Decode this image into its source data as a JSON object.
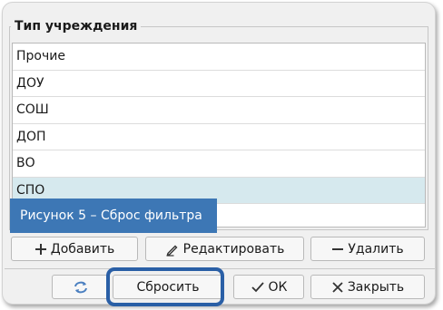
{
  "dialog": {
    "group_title": "Тип учреждения",
    "items": [
      {
        "label": "Прочие"
      },
      {
        "label": "ДОУ"
      },
      {
        "label": "СОШ"
      },
      {
        "label": "ДОП"
      },
      {
        "label": "ВО"
      },
      {
        "label": "СПО"
      }
    ],
    "selected_index": 5,
    "figure_caption": "Рисунок 5 – Сброс фильтра",
    "toolbar": {
      "add_label": "Добавить",
      "edit_label": "Редактировать",
      "delete_label": "Удалить"
    },
    "footer": {
      "reset_label": "Сбросить",
      "ok_label": "ОК",
      "close_label": "Закрыть"
    }
  },
  "colors": {
    "accent": "#2a5fa6",
    "caption_bg": "#3d77b5",
    "selected_row": "#d6e9ee"
  }
}
